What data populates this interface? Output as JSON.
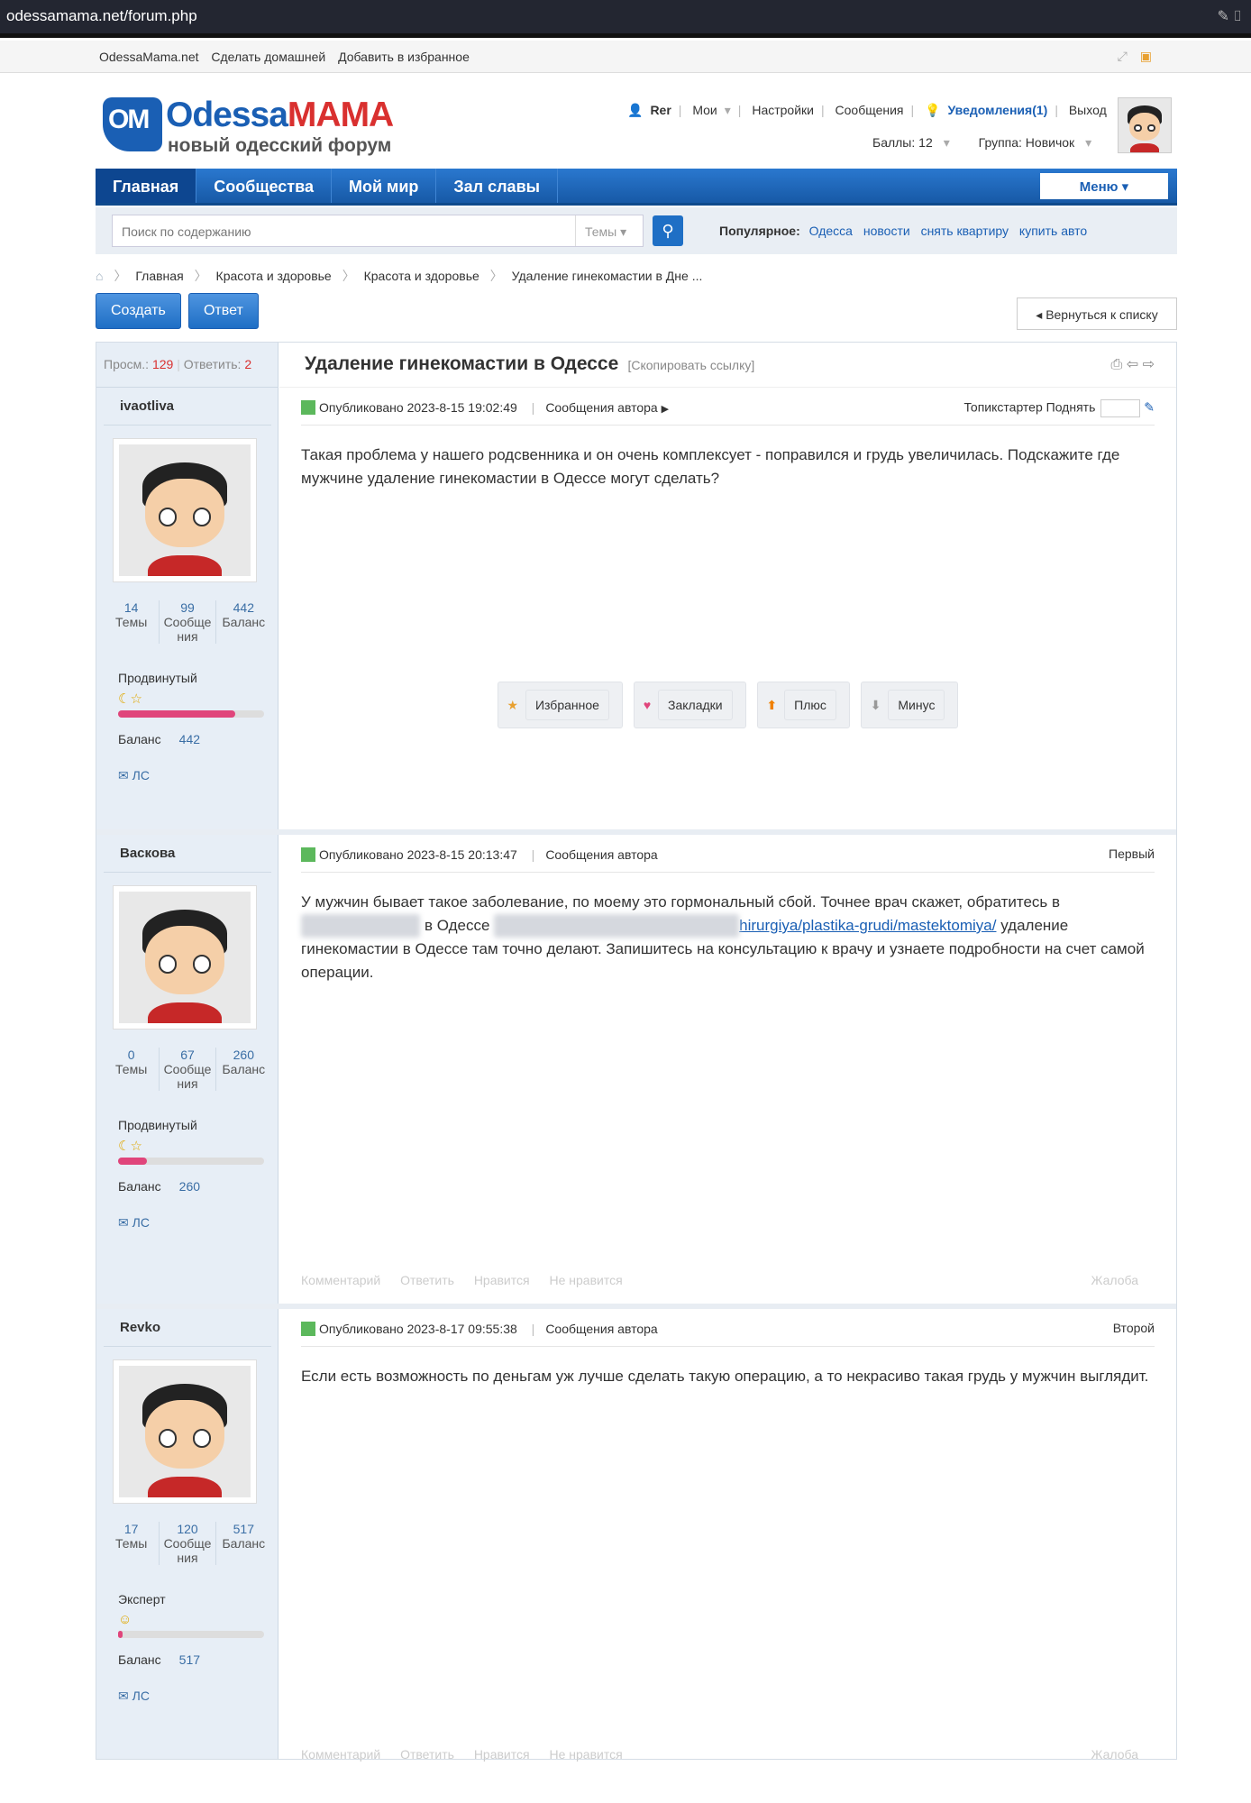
{
  "browser": {
    "url": "odessamama.net/forum.php"
  },
  "topstrip": {
    "site": "OdessaMama.net",
    "home": "Сделать домашней",
    "fav": "Добавить в избранное"
  },
  "logo": {
    "om": "OM",
    "name_a": "Odessa",
    "name_b": "MAMA",
    "tagline": "новый одесский форум"
  },
  "user": {
    "name": "Rer",
    "mine": "Мои",
    "settings": "Настройки",
    "messages": "Сообщения",
    "notifications": "Уведомления(1)",
    "logout": "Выход",
    "points": "Баллы: 12",
    "group": "Группа: Новичок"
  },
  "nav": {
    "items": [
      "Главная",
      "Сообщества",
      "Мой мир",
      "Зал славы"
    ],
    "menu": "Меню"
  },
  "search": {
    "placeholder": "Поиск по содержанию",
    "scope": "Темы",
    "popular_label": "Популярное:",
    "popular": [
      "Одесса",
      "новости",
      "снять квартиру",
      "купить авто"
    ]
  },
  "breadcrumbs": [
    "Главная",
    "Красота и здоровье",
    "Красота и здоровье",
    "Удаление гинекомастии в Дне ..."
  ],
  "buttons": {
    "create": "Создать",
    "reply": "Ответ",
    "back": "Вернуться к списку"
  },
  "thread": {
    "views_label": "Просм.:",
    "views": "129",
    "replies_label": "Ответить:",
    "replies": "2",
    "title": "Удаление гинекомастии в Одессе",
    "copy_link": "[Скопировать ссылку]"
  },
  "labels": {
    "topics": "Темы",
    "posts": "Сообще ния",
    "balance": "Баланс",
    "pm": "ЛС",
    "published": "Опубликовано",
    "author_posts": "Сообщения автора"
  },
  "posts": [
    {
      "author": "ivaotliva",
      "topics": "14",
      "posts": "99",
      "balance": "442",
      "rank": "Продвинутый",
      "rank_progress": 0.8,
      "date": "2023-8-15 19:02:49",
      "position": "Топикстартер",
      "raise": "Поднять",
      "text": "Такая проблема у нашего родсвенника и он очень комплексует - поправился и грудь увеличилась. Подскажите где мужчине удаление гинекомастии  в Одессе  могут сделать?",
      "actions": [
        "Избранное",
        "Закладки",
        "Плюс",
        "Минус"
      ]
    },
    {
      "author": "Васкова",
      "topics": "0",
      "posts": "67",
      "balance": "260",
      "rank": "Продвинутый",
      "rank_progress": 0.2,
      "date": "2023-8-15 20:13:47",
      "position": "Первый",
      "text_a": "У мужчин бывает такое заболевание, по моему это гормональный сбой. Точнее врач скажет, обратитесь в",
      "text_b": "в Одессе",
      "link": "hirurgiya/plastika-grudi/mastektomiya/",
      "text_c": "удаление гинекомастии  в Одессе там точно делают. Запишитесь на консультацию к врачу и узнаете подробности на счет самой операции.",
      "footer": [
        "Комментарий",
        "Ответить",
        "Нравится",
        "Не нравится"
      ],
      "report": "Жалоба"
    },
    {
      "author": "Revko",
      "topics": "17",
      "posts": "120",
      "balance": "517",
      "rank": "Эксперт",
      "rank_progress": 0.02,
      "date": "2023-8-17 09:55:38",
      "position": "Второй",
      "text": "Если есть возможность по деньгам уж лучше сделать такую операцию, а то некрасиво такая грудь у мужчин выглядит.",
      "footer": [
        "Комментарий",
        "Ответить",
        "Нравится",
        "Не нравится"
      ],
      "report": "Жалоба"
    }
  ],
  "colors": {
    "brand": "#1a5fb4",
    "accent": "#d9302f",
    "sidebar": "#e7eef6"
  }
}
